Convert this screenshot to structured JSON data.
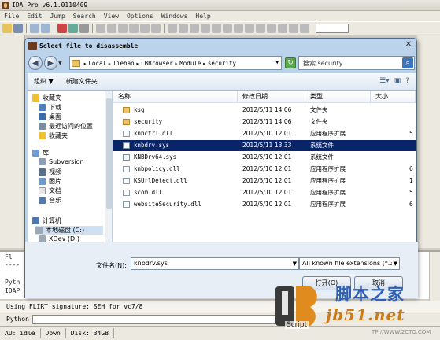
{
  "ida": {
    "title": "IDA Pro v6.1.0110409",
    "menu": [
      "File",
      "Edit",
      "Jump",
      "Search",
      "View",
      "Options",
      "Windows",
      "Help"
    ],
    "output_lines": [
      "Fl",
      "----",
      "Pyth",
      "IDAP"
    ],
    "flirt_line": "Using FLIRT signature: SEH for vc7/8",
    "command_label": "Python",
    "status": [
      "AU:  idle",
      "Down",
      "Disk: 34GB"
    ]
  },
  "dialog": {
    "title": "Select file to disassemble",
    "address": [
      "Local",
      "liebao",
      "LBBrowser",
      "Module",
      "security"
    ],
    "search_placeholder": "搜索 security",
    "toolbar": {
      "organize": "组织 ▼",
      "new_folder": "新建文件夹"
    },
    "nav": {
      "favorites": "收藏夹",
      "downloads": "下载",
      "desktop": "桌面",
      "recent": "最近访问的位置",
      "favorites2": "收藏夹",
      "libraries": "库",
      "subversion": "Subversion",
      "videos": "视频",
      "pictures": "图片",
      "documents": "文档",
      "music": "音乐",
      "computer": "计算机",
      "local_disk": "本地磁盘 (C:)",
      "xdev": "XDev (D:)"
    },
    "columns": {
      "name": "名称",
      "date": "修改日期",
      "type": "类型",
      "size": "大小"
    },
    "files": [
      {
        "name": "ksg",
        "date": "2012/5/11 14:06",
        "type": "文件夹",
        "size": "",
        "kind": "folder"
      },
      {
        "name": "security",
        "date": "2012/5/11 14:06",
        "type": "文件夹",
        "size": "",
        "kind": "folder"
      },
      {
        "name": "knbctrl.dll",
        "date": "2012/5/10 12:01",
        "type": "应用程序扩展",
        "size": "5",
        "kind": "dll"
      },
      {
        "name": "knbdrv.sys",
        "date": "2012/5/11 13:33",
        "type": "系统文件",
        "size": "",
        "kind": "sys"
      },
      {
        "name": "KNBDrv64.sys",
        "date": "2012/5/10 12:01",
        "type": "系统文件",
        "size": "",
        "kind": "sys"
      },
      {
        "name": "knbpolicy.dll",
        "date": "2012/5/10 12:01",
        "type": "应用程序扩展",
        "size": "6",
        "kind": "dll"
      },
      {
        "name": "KSUrlDetect.dll",
        "date": "2012/5/10 12:01",
        "type": "应用程序扩展",
        "size": "1",
        "kind": "dll"
      },
      {
        "name": "scom.dll",
        "date": "2012/5/10 12:01",
        "type": "应用程序扩展",
        "size": "5",
        "kind": "dll"
      },
      {
        "name": "websiteSecurity.dll",
        "date": "2012/5/10 12:01",
        "type": "应用程序扩展",
        "size": "6",
        "kind": "dll"
      }
    ],
    "selected_index": 3,
    "filename_label": "文件名(N):",
    "filename_value": "knbdrv.sys",
    "filetype_value": "All known file extensions (*.3",
    "open_button": "打开(O)",
    "cancel_button": "取消"
  },
  "watermark": {
    "script_label": "Script",
    "cn_text": "脚本之家",
    "url": "jb51.net",
    "site": "TP://WWW.2CTO.COM"
  },
  "colors": {
    "selection": "#0a246a",
    "dialog_frame": "#bcd3ec",
    "watermark_blue": "#2e5fb4",
    "watermark_orange": "#c97a1a"
  }
}
